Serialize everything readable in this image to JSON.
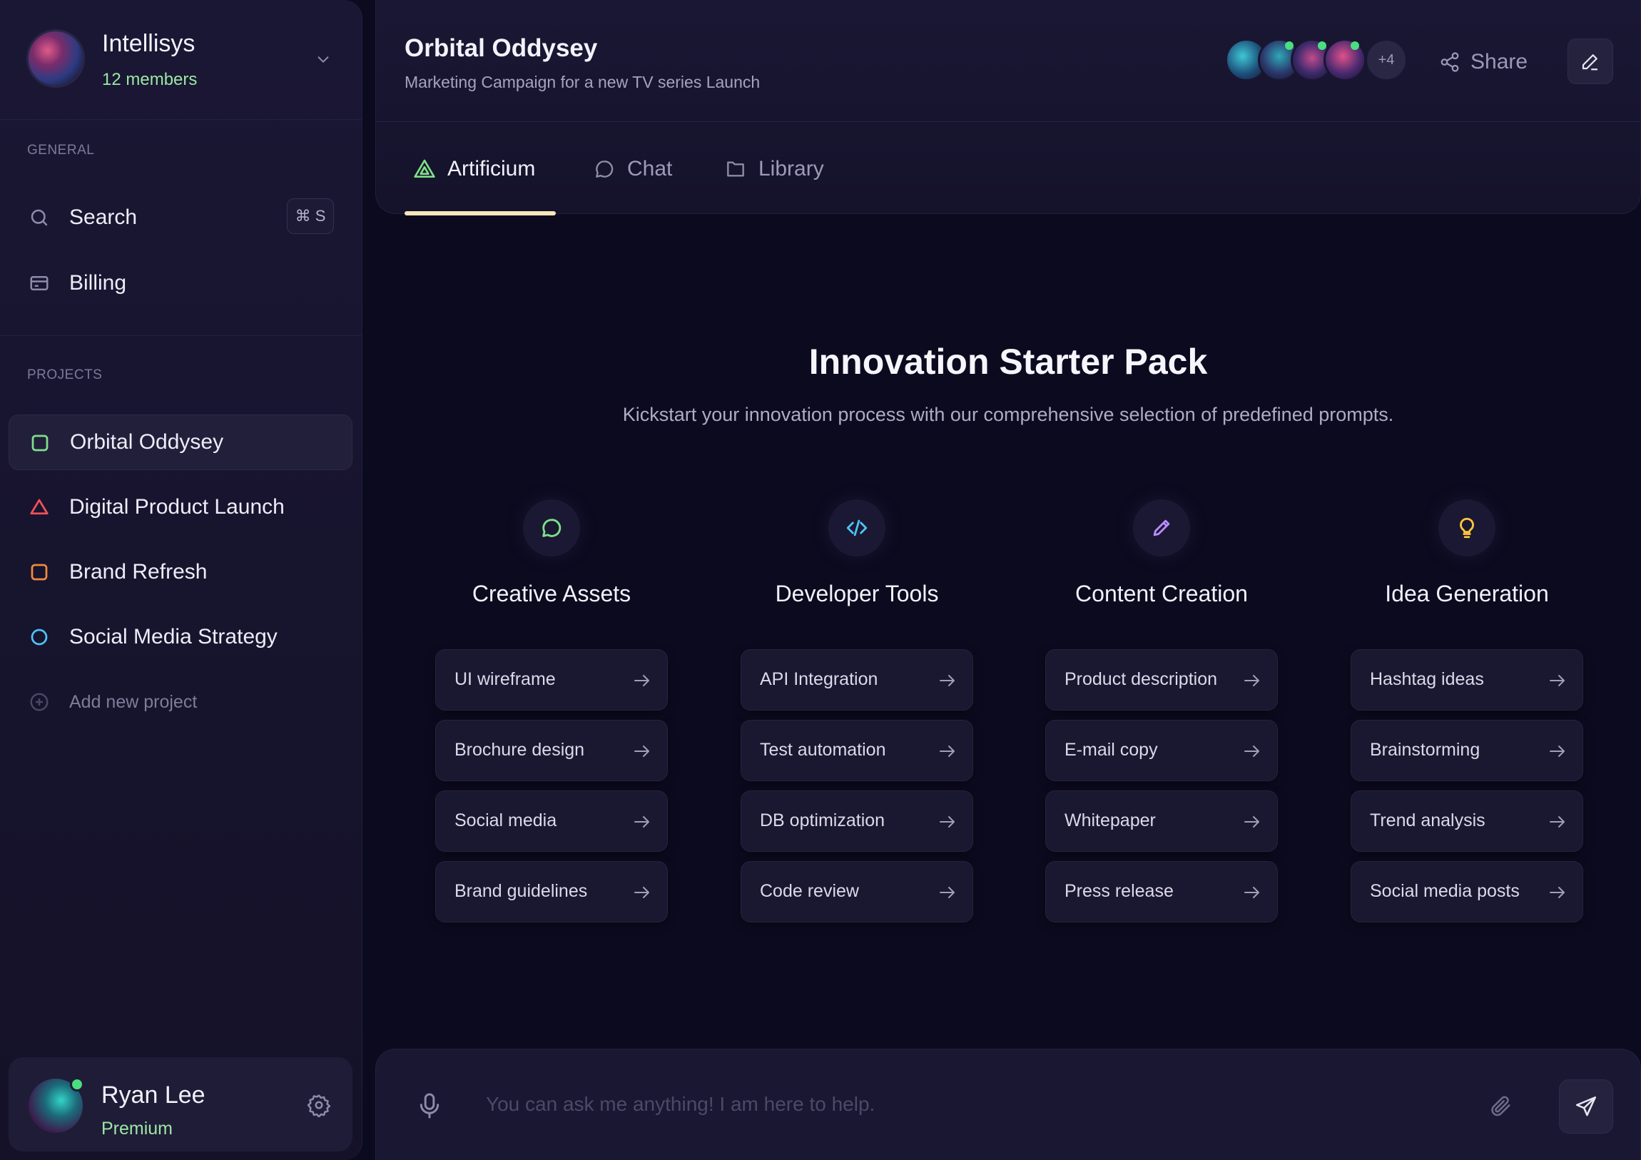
{
  "workspace": {
    "name": "Intellisys",
    "members": "12 members"
  },
  "sidebar": {
    "general_label": "GENERAL",
    "general_items": [
      {
        "label": "Search",
        "shortcut": "⌘ S",
        "icon": "search-icon"
      },
      {
        "label": "Billing",
        "icon": "credit-card-icon"
      }
    ],
    "projects_label": "PROJECTS",
    "projects": [
      {
        "label": "Orbital Oddysey",
        "icon": "square-icon",
        "color": "#7ee08a"
      },
      {
        "label": "Digital Product Launch",
        "icon": "triangle-icon",
        "color": "#f0505a"
      },
      {
        "label": "Brand Refresh",
        "icon": "square-icon",
        "color": "#f08a3c"
      },
      {
        "label": "Social Media Strategy",
        "icon": "circle-icon",
        "color": "#4fc3f7"
      }
    ],
    "add_project": "Add new project"
  },
  "user": {
    "name": "Ryan Lee",
    "plan": "Premium"
  },
  "header": {
    "title": "Orbital Oddysey",
    "subtitle": "Marketing Campaign for a new TV series Launch",
    "extra_members": "+4",
    "share_label": "Share"
  },
  "tabs": [
    {
      "label": "Artificium",
      "icon": "artificium-icon",
      "active": true
    },
    {
      "label": "Chat",
      "icon": "chat-bubble-icon"
    },
    {
      "label": "Library",
      "icon": "folder-icon"
    }
  ],
  "hero": {
    "title": "Innovation Starter Pack",
    "subtitle": "Kickstart your innovation process with our comprehensive selection of predefined prompts."
  },
  "categories": [
    {
      "title": "Creative Assets",
      "icon": "chat-bubble-icon",
      "color": "#7ee08a",
      "prompts": [
        "UI wireframe",
        "Brochure design",
        "Social media",
        "Brand guidelines"
      ]
    },
    {
      "title": "Developer Tools",
      "icon": "code-icon",
      "color": "#4fc3f7",
      "prompts": [
        "API Integration",
        "Test automation",
        "DB optimization",
        "Code review"
      ]
    },
    {
      "title": "Content Creation",
      "icon": "pencil-icon",
      "color": "#b78cff",
      "prompts": [
        "Product description",
        "E-mail copy",
        "Whitepaper",
        "Press release"
      ]
    },
    {
      "title": "Idea Generation",
      "icon": "lightbulb-icon",
      "color": "#ffc53d",
      "prompts": [
        "Hashtag ideas",
        "Brainstorming",
        "Trend analysis",
        "Social media posts"
      ]
    }
  ],
  "composer": {
    "placeholder": "You can ask me anything! I am here to help."
  }
}
